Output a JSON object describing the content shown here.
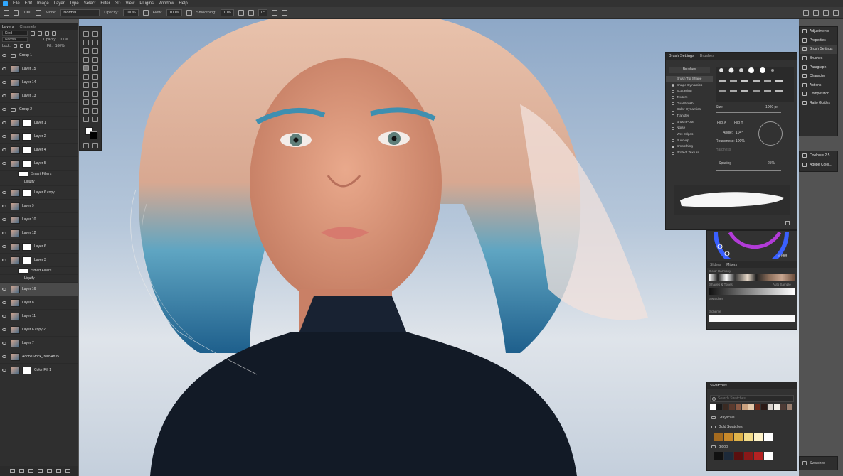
{
  "menu": [
    "File",
    "Edit",
    "Image",
    "Layer",
    "Type",
    "Select",
    "Filter",
    "3D",
    "View",
    "Plugins",
    "Window",
    "Help"
  ],
  "options": {
    "mode_label": "Mode:",
    "mode_value": "Normal",
    "opacity_label": "Opacity:",
    "opacity_value": "100%",
    "flow_label": "Flow:",
    "flow_value": "100%",
    "smoothing_label": "Smoothing:",
    "smoothing_value": "10%",
    "angle_value": "0°",
    "brush_size": "1000"
  },
  "layers_panel": {
    "tabs": [
      "Layers",
      "Channels"
    ],
    "kind": "Kind",
    "blend": "Normal",
    "opacity_label": "Opacity:",
    "opacity_value": "100%",
    "lock_label": "Lock:",
    "fill_label": "Fill:",
    "fill_value": "100%",
    "items": [
      {
        "name": "Group 1",
        "type": "group"
      },
      {
        "name": "Layer 15",
        "type": "layer"
      },
      {
        "name": "Layer 14",
        "type": "layer"
      },
      {
        "name": "Layer 13",
        "type": "layer"
      },
      {
        "name": "Group 2",
        "type": "group"
      },
      {
        "name": "Layer 1",
        "type": "mask"
      },
      {
        "name": "Layer 2",
        "type": "mask"
      },
      {
        "name": "Layer 4",
        "type": "mask"
      },
      {
        "name": "Layer 5",
        "type": "mask"
      },
      {
        "name": "Smart Filters",
        "type": "sub"
      },
      {
        "name": "Liquify",
        "type": "sub2"
      },
      {
        "name": "Layer 6 copy",
        "type": "mask"
      },
      {
        "name": "Layer 9",
        "type": "layer"
      },
      {
        "name": "Layer 10",
        "type": "layer"
      },
      {
        "name": "Layer 12",
        "type": "layer"
      },
      {
        "name": "Layer 6",
        "type": "mask"
      },
      {
        "name": "Layer 3",
        "type": "mask"
      },
      {
        "name": "Smart Filters",
        "type": "sub"
      },
      {
        "name": "Liquify",
        "type": "sub2"
      },
      {
        "name": "Layer 16",
        "type": "layer",
        "active": true
      },
      {
        "name": "Layer 8",
        "type": "layer"
      },
      {
        "name": "Layer 11",
        "type": "layer"
      },
      {
        "name": "Layer 6 copy 2",
        "type": "layer"
      },
      {
        "name": "Layer 7",
        "type": "layer"
      },
      {
        "name": "AdobeStock_300948051",
        "type": "layer"
      },
      {
        "name": "Color Fill 1",
        "type": "mask"
      }
    ]
  },
  "brush_settings": {
    "tabs": [
      "Brush Settings",
      "Brushes"
    ],
    "brushes_btn": "Brushes",
    "rows": [
      {
        "label": "Brush Tip Shape",
        "checked": false
      },
      {
        "label": "Shape Dynamics",
        "checked": true
      },
      {
        "label": "Scattering",
        "checked": false
      },
      {
        "label": "Texture",
        "checked": false
      },
      {
        "label": "Dual Brush",
        "checked": false
      },
      {
        "label": "Color Dynamics",
        "checked": false
      },
      {
        "label": "Transfer",
        "checked": false
      },
      {
        "label": "Brush Pose",
        "checked": false
      },
      {
        "label": "Noise",
        "checked": false
      },
      {
        "label": "Wet Edges",
        "checked": false
      },
      {
        "label": "Build-up",
        "checked": false
      },
      {
        "label": "Smoothing",
        "checked": true
      },
      {
        "label": "Protect Texture",
        "checked": false
      }
    ],
    "size_label": "Size",
    "size_value": "1000 px",
    "flipx": "Flip X",
    "flipy": "Flip Y",
    "angle_label": "Angle:",
    "angle_value": "104°",
    "roundness_label": "Roundness:",
    "roundness_value": "100%",
    "hardness_label": "Hardness",
    "spacing_label": "Spacing",
    "spacing_value": "25%"
  },
  "color_panel": {
    "tabs": [
      "Sliders",
      "Mixers"
    ],
    "hex": "# ffffff",
    "color_label": "Color Harmony",
    "shades_label": "Shades & Tones",
    "auto_sample": "Auto Sample",
    "swatch_label": "Swatches",
    "scheme": "Scheme"
  },
  "swatches": {
    "title": "Swatches",
    "search_placeholder": "Search Swatches",
    "top": [
      "#ffffff",
      "#1a1a1a",
      "#3a2a22",
      "#5a3a2e",
      "#8a5a46",
      "#c9a07e",
      "#e5c9aa",
      "#6b2a1a",
      "#2b1a16",
      "#d8d2cc",
      "#f2efe8",
      "#4d3b36",
      "#9a7f70"
    ],
    "groups": [
      {
        "name": "Grayscale"
      },
      {
        "name": "Gold Swatches",
        "colors": [
          "#a46a1e",
          "#c8892a",
          "#e0b34a",
          "#f4dc8a",
          "#fff3c9",
          "#ffffff"
        ]
      },
      {
        "name": "Blood",
        "colors": [
          "#111111",
          "#1d2a3a",
          "#5a0f0f",
          "#8a1818",
          "#b52222",
          "#ffffff"
        ]
      }
    ]
  },
  "dock": [
    {
      "label": "Adjustments"
    },
    {
      "label": "Properties"
    },
    {
      "label": "Brush Settings",
      "active": true
    },
    {
      "label": "Brushes"
    },
    {
      "label": "Paragraph"
    },
    {
      "label": "Character"
    },
    {
      "label": "Actions"
    },
    {
      "label": "Composition..."
    },
    {
      "label": "Ratio Guides"
    }
  ],
  "dock2": [
    {
      "label": "Coolorus 2.5"
    },
    {
      "label": "Adobe Color..."
    }
  ],
  "dock3": {
    "label": "Swatches"
  }
}
